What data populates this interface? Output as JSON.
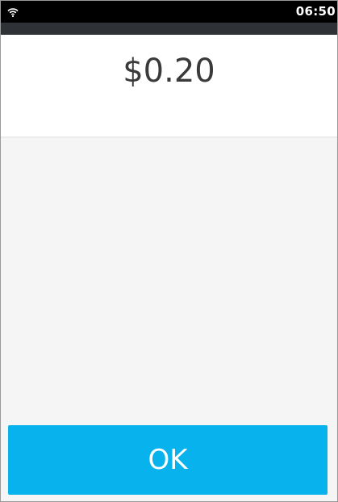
{
  "status_bar": {
    "time": "06:50",
    "wifi_icon": "wifi-icon",
    "background": "#000000"
  },
  "amount_panel": {
    "amount": "$0.20"
  },
  "actions": {
    "ok_label": "OK",
    "ok_color": "#08b2ec"
  }
}
